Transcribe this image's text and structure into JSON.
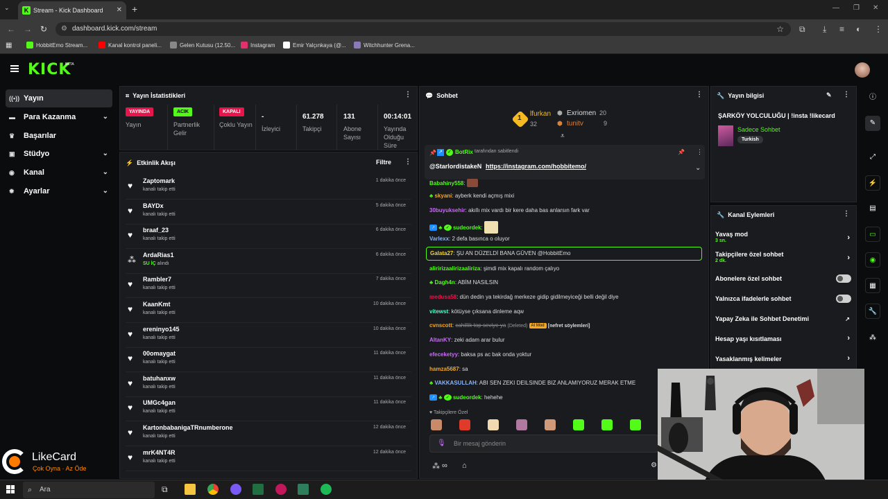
{
  "browser": {
    "tab_title": "Stream - Kick Dashboard",
    "url": "dashboard.kick.com/stream",
    "bookmarks": [
      {
        "label": "HobbitEmo Stream...",
        "color": "#53fc18"
      },
      {
        "label": "Kanal kontrol paneli...",
        "color": "#ff0000"
      },
      {
        "label": "Gelen Kutusu (12.50...",
        "color": "#888888"
      },
      {
        "label": "Instagram",
        "color": "#e1306c"
      },
      {
        "label": "Emir Yalçınkaya (@...",
        "color": "#ffffff"
      },
      {
        "label": "Witchhunter Grena...",
        "color": "#8a7ab8"
      }
    ]
  },
  "header": {
    "logo": "KICK",
    "beta": "BETA"
  },
  "nav": {
    "items": [
      {
        "label": "Yayın",
        "icon": "broadcast-icon"
      },
      {
        "label": "Para Kazanma",
        "icon": "money-icon"
      },
      {
        "label": "Başarılar",
        "icon": "trophy-icon"
      },
      {
        "label": "Stüdyo",
        "icon": "studio-icon"
      },
      {
        "label": "Kanal",
        "icon": "channel-icon"
      },
      {
        "label": "Ayarlar",
        "icon": "gear-icon"
      }
    ]
  },
  "sponsor": {
    "name": "LikeCard",
    "tagline": "Çok Oyna · Az Öde"
  },
  "stats": {
    "title": "Yayın İstatistikleri",
    "cols": [
      {
        "badge": "YAYINDA",
        "badge_color": "#e8154c",
        "label": "Yayın"
      },
      {
        "badge": "ACIK",
        "badge_color": "#53fc18",
        "label": "Partnerlik Gelir"
      },
      {
        "badge": "KAPALI",
        "badge_color": "#e8154c",
        "label": "Çoklu Yayın"
      },
      {
        "value": "-",
        "label": "İzleyici"
      },
      {
        "value": "61.278",
        "label": "Takipçi"
      },
      {
        "value": "131",
        "label": "Abone Sayısı"
      },
      {
        "value": "00:14:01",
        "label": "Yayında Olduğu Süre"
      }
    ]
  },
  "activity": {
    "title": "Etkinlik Akışı",
    "filter": "Filtre",
    "items": [
      {
        "name": "Zaptomark",
        "sub": "kanalı takip etti",
        "time": "1 dakika önce",
        "icon": "heart-icon"
      },
      {
        "name": "BAYDx",
        "sub": "kanalı takip etti",
        "time": "5 dakika önce",
        "icon": "heart-icon"
      },
      {
        "name": "braaf_23",
        "sub": "kanalı takip etti",
        "time": "6 dakika önce",
        "icon": "heart-icon"
      },
      {
        "name": "ArdaRias1",
        "sub_prefix": "SU İÇ",
        "sub": "alındı",
        "time": "6 dakika önce",
        "icon": "reward-icon"
      },
      {
        "name": "Rambler7",
        "sub": "kanalı takip etti",
        "time": "7 dakika önce",
        "icon": "heart-icon"
      },
      {
        "name": "KaanKmt",
        "sub": "kanalı takip etti",
        "time": "10 dakika önce",
        "icon": "heart-icon"
      },
      {
        "name": "ereninyo145",
        "sub": "kanalı takip etti",
        "time": "10 dakika önce",
        "icon": "heart-icon"
      },
      {
        "name": "00omaygat",
        "sub": "kanalı takip etti",
        "time": "11 dakika önce",
        "icon": "heart-icon"
      },
      {
        "name": "batuhanxw",
        "sub": "kanalı takip etti",
        "time": "11 dakika önce",
        "icon": "heart-icon"
      },
      {
        "name": "UMGc4gan",
        "sub": "kanalı takip etti",
        "time": "11 dakika önce",
        "icon": "heart-icon"
      },
      {
        "name": "KartonbabanigaTRnumberone",
        "sub": "kanalı takip etti",
        "time": "12 dakika önce",
        "icon": "heart-icon"
      },
      {
        "name": "mrK4NT4R",
        "sub": "kanalı takip etti",
        "time": "12 dakika önce",
        "icon": "heart-icon"
      }
    ]
  },
  "chat": {
    "title": "Sohbet",
    "leaderboard": {
      "first_rank": "1",
      "first_name": "lfurkan",
      "first_score": "32",
      "others": [
        {
          "name": "Exriomen",
          "score": "20"
        },
        {
          "name": "tunitv",
          "score": "9"
        }
      ]
    },
    "pinned": {
      "by": "BotRix",
      "by_suffix": "tarafından sabitlendi",
      "text_user": "@StarlordistakeN",
      "text_link": "https://instagram.com/hobbitemo/"
    },
    "messages": [
      {
        "user": "Babahiny558",
        "color": "#53fc18",
        "text": ""
      },
      {
        "user": "skyani",
        "color": "#f5a623",
        "text": "ayberk kendi açmış mixi"
      },
      {
        "user": "30buyuksehir",
        "color": "#c86cf5",
        "text": "akıllı mix vardı bir kere daha bas anlarsın fark var"
      },
      {
        "user": "sudeordek",
        "color": "#53fc18",
        "text": ""
      },
      {
        "user": "Varlexx",
        "color": "#8ab4f8",
        "text": "2 defa basınca o oluyor"
      },
      {
        "user": "Galata27",
        "color": "#f5d623",
        "text": "ŞU AN DÜZELDİ BANA GÜVEN @HobbitEmo"
      },
      {
        "user": "aliririzaalirizaaliriza",
        "color": "#53fc18",
        "text": "şimdi mix kapalı random çalıyo"
      },
      {
        "user": "Dagh4n",
        "color": "#53fc18",
        "text": "ABİM NASILSIN"
      },
      {
        "user": "medusa58",
        "color": "#e8154c",
        "text": "dün dedin ya tekirdağ merkeze gidip gidilmeyiceği belli değil diye"
      },
      {
        "user": "vitewst",
        "color": "#53fcc8",
        "text": "kötüyse çıksana dinleme aqw"
      },
      {
        "user": "cvnscott",
        "color": "#f5a623",
        "text": "cahillik top seviye ya",
        "deleted": "(Deleted)",
        "mod": "AI Mod",
        "reason": "[nefret söylemleri]"
      },
      {
        "user": "AltanKY",
        "color": "#c86cf5",
        "text": "zeki adam arar bulur"
      },
      {
        "user": "efeceketyy",
        "color": "#c86cf5",
        "text": "baksa ps ac bak onda yoktur"
      },
      {
        "user": "hamza5687",
        "color": "#f5a623",
        "text": "sa"
      },
      {
        "user": "VAKKASULLAH",
        "color": "#8ab4f8",
        "text": "ABI SEN ZEKI DEILSINDE BIZ ANLAMIYORUZ MERAK ETME"
      },
      {
        "user": "sudeordek",
        "color": "#53fc18",
        "text": "hehehe"
      }
    ],
    "followers_only": "Takipçilere Özel",
    "input_placeholder": "Bir mesaj gönderin"
  },
  "stream_info": {
    "title": "Yayın bilgisi",
    "stream_title": "ŞARKÖY YOLCULUĞU | !insta !likecard",
    "category": "Sadece Sohbet",
    "tag": "Turkish"
  },
  "channel_actions": {
    "title": "Kanal Eylemleri",
    "items": [
      {
        "label": "Yavaş mod",
        "sub": "3 sn.",
        "control": "arrow"
      },
      {
        "label": "Takipçilere özel sohbet",
        "sub": "2 dk.",
        "control": "arrow"
      },
      {
        "label": "Abonelere özel sohbet",
        "sub": "",
        "control": "toggle"
      },
      {
        "label": "Yalnızca ifadelerle sohbet",
        "sub": "",
        "control": "toggle"
      },
      {
        "label": "Yapay Zeka ile Sohbet Denetimi",
        "sub": "",
        "control": "external"
      },
      {
        "label": "Hesap yaşı kısıtlaması",
        "sub": "",
        "control": "arrow"
      },
      {
        "label": "Yasaklanmış kelimeler",
        "sub": "",
        "control": "arrow"
      }
    ]
  },
  "taskbar": {
    "search": "Ara"
  }
}
